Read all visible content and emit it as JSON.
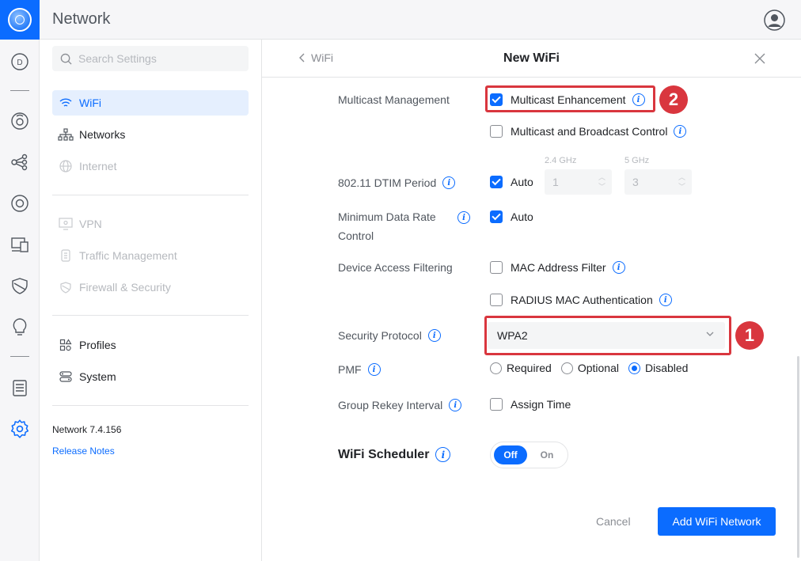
{
  "app": {
    "title": "Network"
  },
  "search": {
    "placeholder": "Search Settings"
  },
  "sidebar": {
    "items": [
      {
        "label": "WiFi",
        "icon": "wifi-icon",
        "active": true
      },
      {
        "label": "Networks",
        "icon": "topology-icon"
      },
      {
        "label": "Internet",
        "icon": "globe-icon",
        "disabled": true
      },
      {
        "label": "VPN",
        "icon": "vpn-icon",
        "disabled": true
      },
      {
        "label": "Traffic Management",
        "icon": "traffic-icon",
        "disabled": true
      },
      {
        "label": "Firewall & Security",
        "icon": "shield-icon",
        "disabled": true
      },
      {
        "label": "Profiles",
        "icon": "profiles-icon"
      },
      {
        "label": "System",
        "icon": "system-icon"
      }
    ],
    "version": "Network 7.4.156",
    "release_notes": "Release Notes"
  },
  "panel": {
    "back_label": "WiFi",
    "title": "New WiFi",
    "multicast": {
      "label": "Multicast Management",
      "enhancement": "Multicast Enhancement",
      "enhancement_checked": true,
      "broadcast_control": "Multicast and Broadcast Control",
      "broadcast_checked": false
    },
    "dtim": {
      "label": "802.11 DTIM Period",
      "auto": "Auto",
      "auto_checked": true,
      "band_24": "2.4 GHz",
      "band_5": "5 GHz",
      "value_24": "1",
      "value_5": "3"
    },
    "min_rate": {
      "label": "Minimum Data Rate Control",
      "auto": "Auto",
      "auto_checked": true
    },
    "access_filter": {
      "label": "Device Access Filtering",
      "mac": "MAC Address Filter",
      "radius": "RADIUS MAC Authentication"
    },
    "security": {
      "label": "Security Protocol",
      "value": "WPA2"
    },
    "pmf": {
      "label": "PMF",
      "options": [
        "Required",
        "Optional",
        "Disabled"
      ],
      "selected": "Disabled"
    },
    "rekey": {
      "label": "Group Rekey Interval",
      "assign": "Assign Time"
    },
    "scheduler": {
      "label": "WiFi Scheduler",
      "off": "Off",
      "on": "On",
      "state": "Off"
    },
    "cancel": "Cancel",
    "submit": "Add WiFi Network"
  },
  "annotations": {
    "badge_1": "1",
    "badge_2": "2"
  },
  "colors": {
    "accent": "#0b6cff",
    "annotation": "#d9363e",
    "text_muted": "#50565e"
  }
}
